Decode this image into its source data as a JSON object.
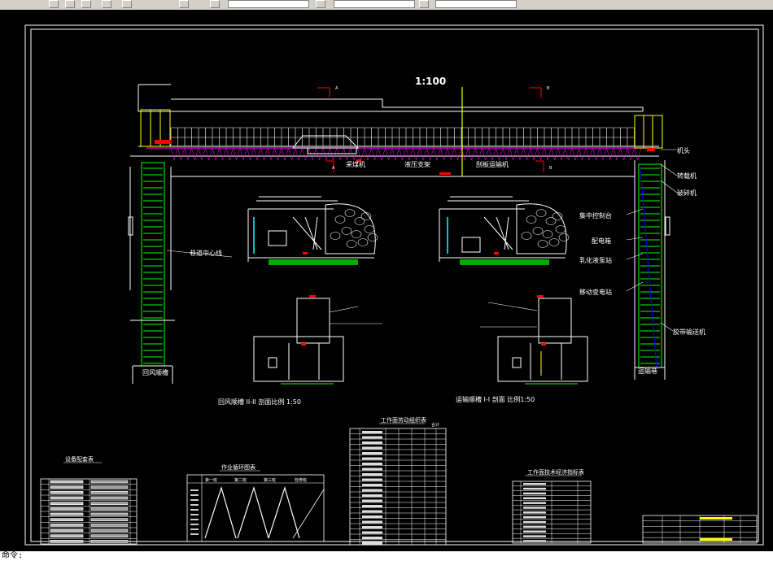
{
  "colors": {
    "background": "#000000",
    "frame": "#ffffff",
    "structure": "#ffffff",
    "support": "#ffff00",
    "belt": "#00ff00",
    "accent": "#ff0000",
    "cyan": "#00ffff",
    "magenta": "#ff00ff"
  },
  "toolbar": {
    "icons": [
      "open-icon",
      "save-icon",
      "print-icon",
      "cut-icon",
      "paint-icon",
      "layer-icon",
      "properties-icon",
      "color-icon"
    ]
  },
  "drawing": {
    "scale_label": "1:100",
    "section_mark_a": "A",
    "section_mark_b": "B",
    "callouts_top": {
      "cutter": "采煤机",
      "support": "液压支架",
      "conveyor": "刮板运输机"
    },
    "callouts_right": [
      "机头",
      "转载机",
      "破碎机",
      "集中控制台",
      "配电箱",
      "乳化液泵站",
      "移动变电站",
      "胶带输送机"
    ],
    "left_label": "巷道中心线",
    "left_roadway_label": "回风顺槽",
    "right_roadway_label": "运输巷",
    "section_left_caption": "回风顺槽 II-II 剖面比例   1:50",
    "section_right_caption": "运输顺槽 I-I 剖面   比例1:50",
    "table_equipment_title": "设备配套表",
    "table_cycle_title": "作业循环图表",
    "cycle_legend": [
      "第一班",
      "第二班",
      "第三班",
      "检修班"
    ],
    "table_labor_title": "工作面劳动组织表",
    "table_labor_total": "合计",
    "table_tech_title": "工作面技术经济指标表"
  },
  "statusbar": {
    "text": "命令: "
  }
}
